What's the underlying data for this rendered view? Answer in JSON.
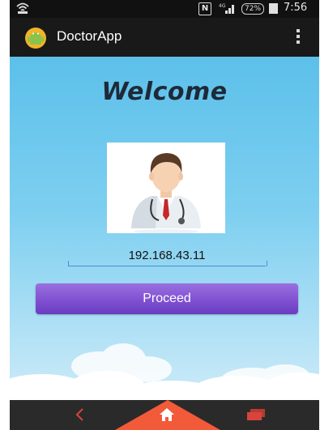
{
  "status_bar": {
    "wifi_icon": "wifi-icon",
    "nfc_label": "N",
    "network_label": "4G",
    "battery_percent": "72%",
    "time": "7:56"
  },
  "action_bar": {
    "app_icon": "android-app-icon",
    "title": "DoctorApp",
    "overflow_icon": "overflow-menu-icon"
  },
  "main": {
    "heading": "Welcome",
    "doctor_image": "doctor-avatar-image",
    "ip_field": {
      "value": "192.168.43.11",
      "placeholder": ""
    },
    "proceed_label": "Proceed"
  },
  "colors": {
    "background_top": "#5cc0ea",
    "button_purple": "#7d4fd0",
    "nav_home_orange": "#f25a3a",
    "nav_bar": "#2a2a2a"
  },
  "nav_bar": {
    "back_icon": "back-icon",
    "home_icon": "home-icon",
    "recent_icon": "recent-apps-icon"
  }
}
